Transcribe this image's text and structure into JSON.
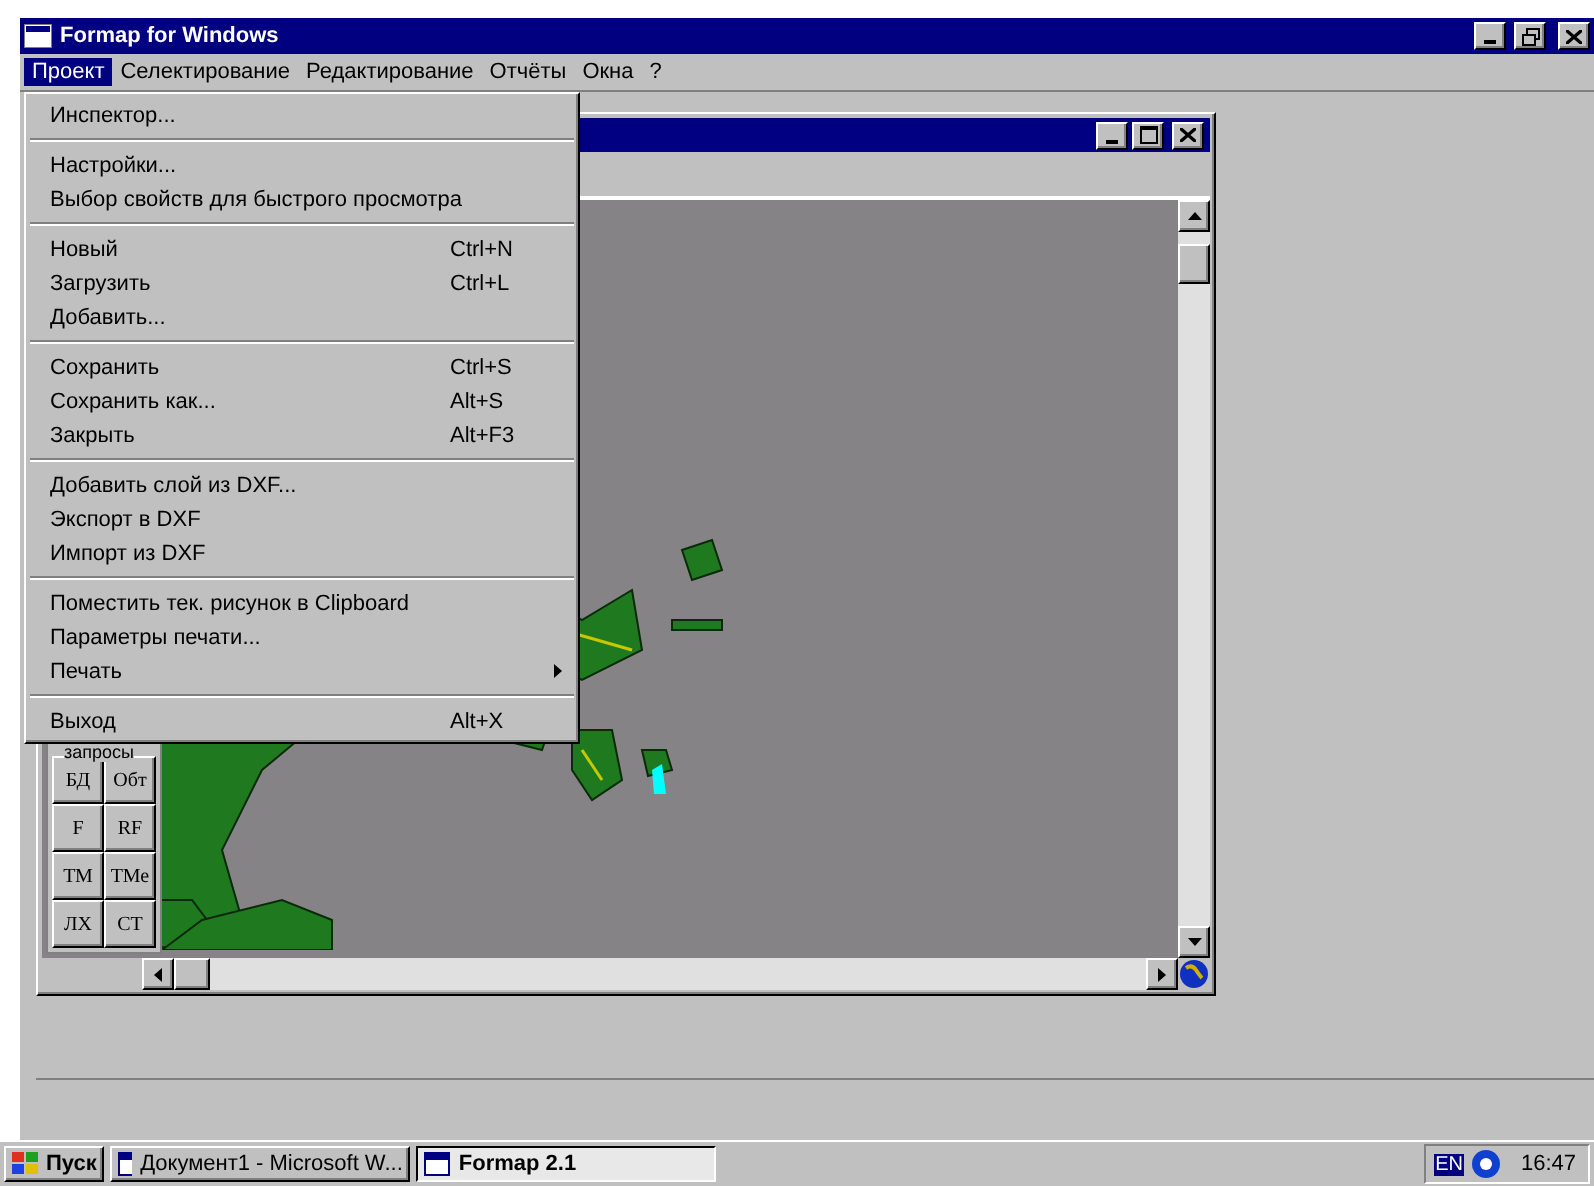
{
  "window": {
    "title": "Formap for Windows"
  },
  "menu_bar": [
    {
      "label": "Проект",
      "selected": true
    },
    {
      "label": "Селектирование",
      "selected": false
    },
    {
      "label": "Редактирование",
      "selected": false
    },
    {
      "label": "Отчёты",
      "selected": false
    },
    {
      "label": "Окна",
      "selected": false
    },
    {
      "label": "?",
      "selected": false
    }
  ],
  "dropdown": {
    "groups": [
      [
        {
          "label": "Инспектор..."
        }
      ],
      [
        {
          "label": "Настройки..."
        },
        {
          "label": "Выбор свойств для быстрого просмотра"
        }
      ],
      [
        {
          "label": "Новый",
          "shortcut": "Ctrl+N"
        },
        {
          "label": "Загрузить",
          "shortcut": "Ctrl+L"
        },
        {
          "label": "Добавить..."
        }
      ],
      [
        {
          "label": "Сохранить",
          "shortcut": "Ctrl+S"
        },
        {
          "label": "Сохранить как...",
          "shortcut": "Alt+S"
        },
        {
          "label": "Закрыть",
          "shortcut": "Alt+F3"
        }
      ],
      [
        {
          "label": "Добавить слой из DXF..."
        },
        {
          "label": "Экспорт в DXF"
        },
        {
          "label": "Импорт из DXF"
        }
      ],
      [
        {
          "label": "Поместить тек. рисунок в Clipboard"
        },
        {
          "label": "Параметры печати..."
        },
        {
          "label": "Печать",
          "submenu": true
        }
      ],
      [
        {
          "label": "Выход",
          "shortcut": "Alt+X"
        }
      ]
    ]
  },
  "queries_panel": {
    "title": "запросы",
    "buttons": [
      "БД",
      "Обт",
      "F",
      "RF",
      "ТМ",
      "ТМе",
      "ЛХ",
      "СТ"
    ]
  },
  "taskbar": {
    "start": "Пуск",
    "tasks": [
      {
        "label": "Документ1 - Microsoft W...",
        "selected": false
      },
      {
        "label": "Formap 2.1",
        "selected": true
      }
    ],
    "language": "EN",
    "clock": "16:47"
  }
}
